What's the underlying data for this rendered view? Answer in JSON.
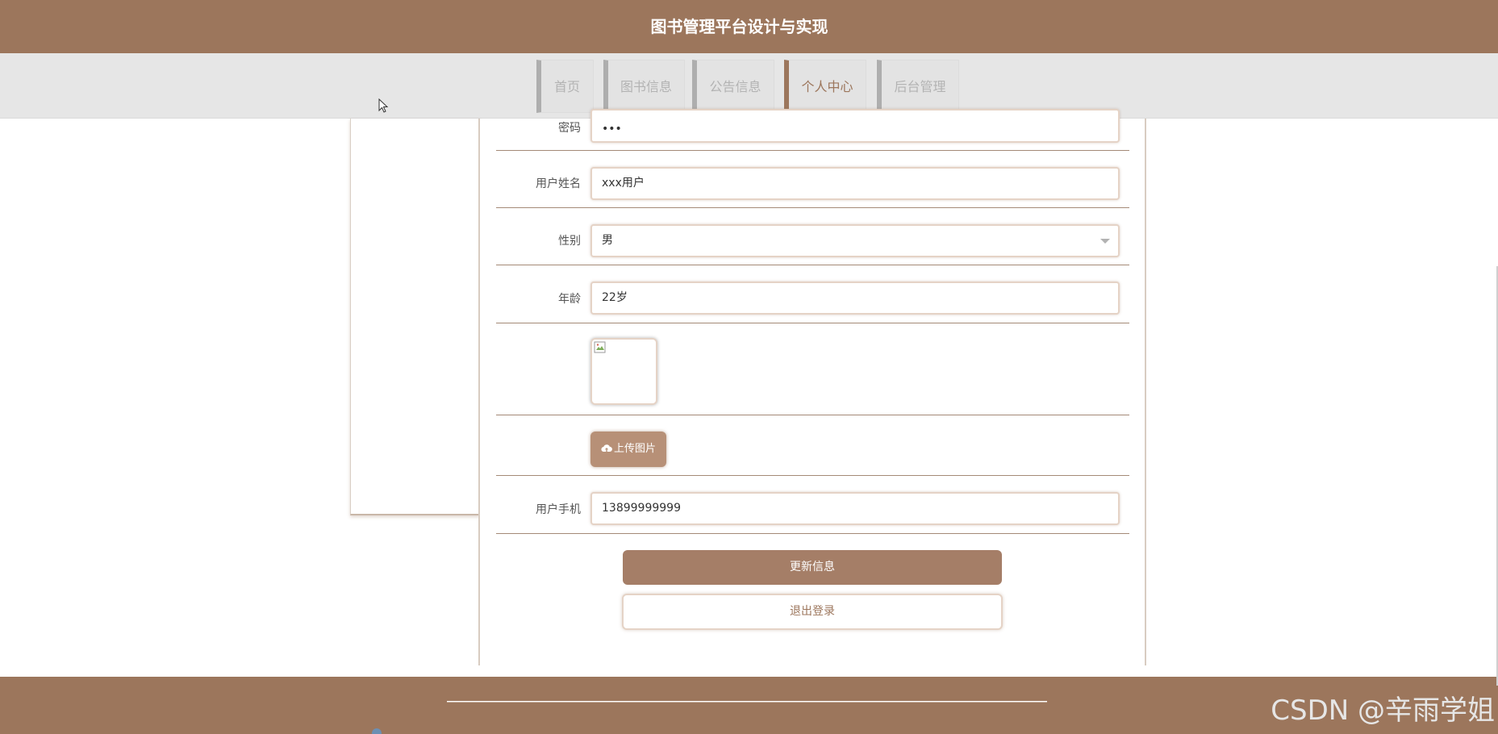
{
  "header": {
    "title": "图书管理平台设计与实现"
  },
  "nav": {
    "items": [
      {
        "label": "首页"
      },
      {
        "label": "图书信息"
      },
      {
        "label": "公告信息"
      },
      {
        "label": "个人中心"
      },
      {
        "label": "后台管理"
      }
    ],
    "active": "个人中心"
  },
  "form": {
    "password_label": "密码",
    "password_value": "•••",
    "name_label": "用户姓名",
    "name_value": "xxx用户",
    "gender_label": "性别",
    "gender_value": "男",
    "age_label": "年龄",
    "age_value": "22岁",
    "upload_label": "上传图片",
    "phone_label": "用户手机",
    "phone_value": "13899999999"
  },
  "buttons": {
    "update": "更新信息",
    "logout": "退出登录"
  },
  "watermark": "CSDN @辛雨学姐",
  "colors": {
    "brand": "#9c765c",
    "nav_bg": "#e6e6e6",
    "button": "#a57e67"
  }
}
